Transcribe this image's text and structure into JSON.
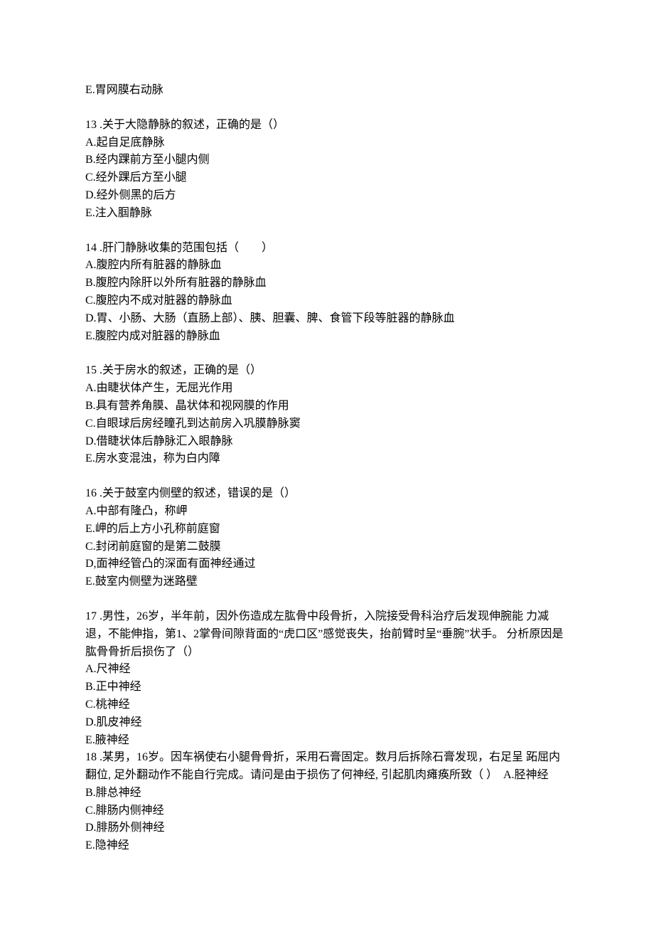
{
  "q12_optE": "E.胃网膜右动脉",
  "q13": {
    "num": "13",
    "stem": " .关于大隐静脉的叙述，正确的是（）",
    "A": "A.起自足底静脉",
    "B": "B.经内踝前方至小腿内侧",
    "C": "C.经外踝后方至小腿",
    "D": "D.经外侧黑的后方",
    "E": "E.注入腘静脉"
  },
  "q14": {
    "num": "14",
    "stem": " .肝门静脉收集的范围包括（　　）",
    "A": "A.腹腔内所有脏器的静脉血",
    "B": "B.腹腔内除肝以外所有脏器的静脉血",
    "C": "C.腹腔内不成对脏器的静脉血",
    "D": "D.胃、小肠、大肠（直肠上部）、胰、胆囊、脾、食管下段等脏器的静脉血",
    "E": "E.腹腔内成对脏器的静脉血"
  },
  "q15": {
    "num": "15",
    "stem": " .关于房水的叙述，正确的是（）",
    "A": "A.由睫状体产生，无屈光作用",
    "B": "B.具有营养角膜、晶状体和视网膜的作用",
    "C": "C.自眼球后房经瞳孔到达前房入巩膜静脉窦",
    "D": "D.借睫状体后静脉汇入眼静脉",
    "E": "E.房水变混浊，称为白内障"
  },
  "q16": {
    "num": "16",
    "stem": " .关于鼓室内侧壁的叙述，错误的是（）",
    "A": "A.中部有隆凸，称岬",
    "B": "E.岬的后上方小孔称前庭窗",
    "C": "C.封闭前庭窗的是第二鼓膜",
    "D": "D,面神经管凸的深面有面神经通过",
    "E": "E.鼓室内侧壁为迷路壁"
  },
  "q17": {
    "num": "17",
    "stem1": " .男性，26岁，半年前，因外伤造成左肱骨中段骨折，入院接受骨科治疗后发现伸腕能 力减退，不能伸指，第1、2掌骨间隙背面的“虎口区”感觉丧失，抬前臂时呈“垂腕”状手。 分析原因是肱骨骨折后损伤了（）",
    "A": "A.尺神经",
    "B": "B.正中神经",
    "C": "C.桃神经",
    "D": "D.肌皮神经",
    "E": "E.腋神经"
  },
  "q18": {
    "num": "18",
    "stem1": " .某男，16岁。因车祸使右小腿骨骨折，采用石膏固定。数月后拆除石膏发现，右足呈 跖屈内翻位, 足外翻动作不能自行完成。请问是由于损伤了何神经, 引起肌肉瘫痪所致（ ）  A.胫神经",
    "B": "B.腓总神经",
    "C": "C.腓肠内侧神经",
    "D": "D.腓肠外侧神经",
    "E": "E.隐神经"
  }
}
